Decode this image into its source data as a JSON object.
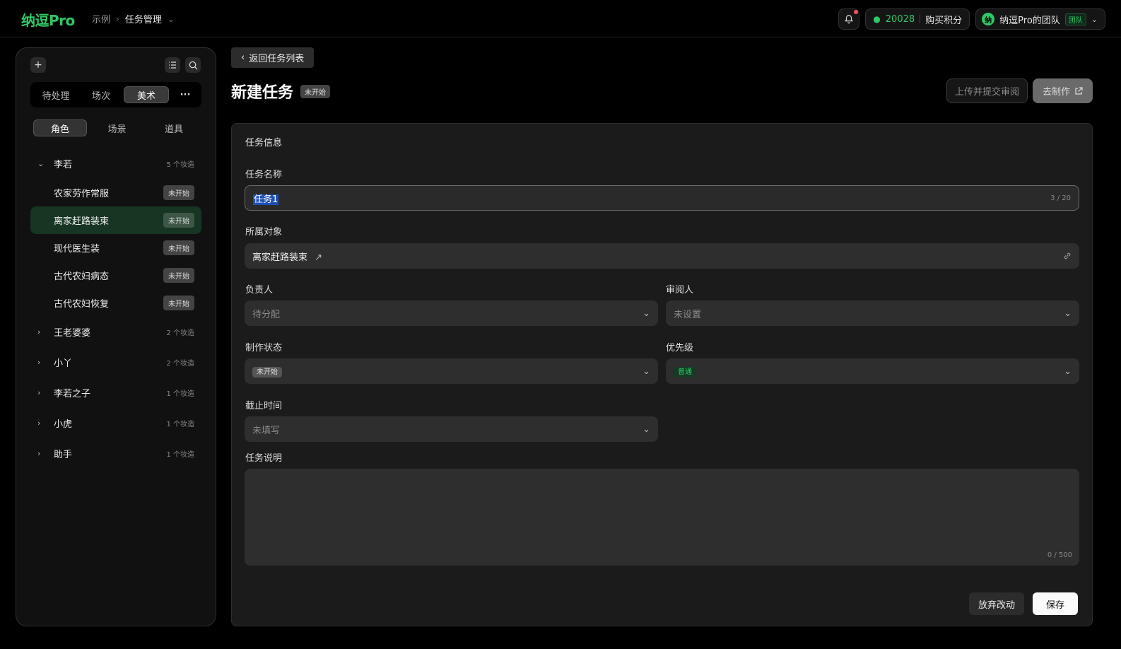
{
  "brand": {
    "logo": "纳逗Pro",
    "accent": "#2ec866"
  },
  "breadcrumb": {
    "items": [
      "示例",
      "任务管理"
    ]
  },
  "header": {
    "points": "20028",
    "buy_points": "购买积分",
    "team_name": "纳逗Pro的团队",
    "team_tag": "团队",
    "avatar_letter": "纳"
  },
  "sidebar": {
    "tabs": [
      "待处理",
      "场次",
      "美术"
    ],
    "active_tab": "美术",
    "subtabs": [
      "角色",
      "场景",
      "道具"
    ],
    "groups": [
      {
        "name": "李若",
        "count": "5 个妆造",
        "expanded": true,
        "items": [
          {
            "name": "农家劳作常服",
            "status": "未开始"
          },
          {
            "name": "离家赶路装束",
            "status": "未开始",
            "selected": true
          },
          {
            "name": "现代医生装",
            "status": "未开始"
          },
          {
            "name": "古代农妇病态",
            "status": "未开始"
          },
          {
            "name": "古代农妇恢复",
            "status": "未开始"
          }
        ]
      },
      {
        "name": "王老婆婆",
        "count": "2 个妆造"
      },
      {
        "name": "小丫",
        "count": "2 个妆造"
      },
      {
        "name": "李若之子",
        "count": "1 个妆造"
      },
      {
        "name": "小虎",
        "count": "1 个妆造"
      },
      {
        "name": "助手",
        "count": "1 个妆造"
      }
    ]
  },
  "page": {
    "back_label": "返回任务列表",
    "title": "新建任务",
    "status": "未开始",
    "submit_label": "上传并提交审阅",
    "go_label": "去制作"
  },
  "form": {
    "section": "任务信息",
    "name_label": "任务名称",
    "name_value": "任务1",
    "name_counter": "3 / 20",
    "object_label": "所属对象",
    "object_value": "离家赶路装束",
    "assignee_label": "负责人",
    "assignee_placeholder": "待分配",
    "reviewer_label": "审阅人",
    "reviewer_placeholder": "未设置",
    "status_label": "制作状态",
    "status_value": "未开始",
    "priority_label": "优先级",
    "priority_value": "普通",
    "deadline_label": "截止时间",
    "deadline_placeholder": "未填写",
    "desc_label": "任务说明",
    "desc_counter": "0 / 500",
    "discard_label": "放弃改动",
    "save_label": "保存"
  }
}
